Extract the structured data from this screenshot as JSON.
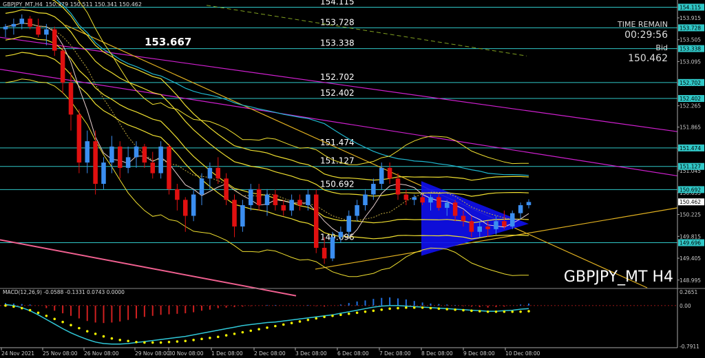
{
  "header": {
    "symbol_info": "GBPJPY_MT,H4",
    "ohlc": "150.379 150.511 150.341 150.462"
  },
  "info_panel": {
    "time_remain_label": "TIME REMAIN",
    "time_remain_value": "00:29:56",
    "bid_label": "Bid",
    "bid_value": "150.462"
  },
  "watermark": "GBPJPY_MT H4",
  "highlight_price": "153.667",
  "colors": {
    "background": "#000000",
    "level_line": "#30c8c8",
    "bull_candle": "#3b8ef0",
    "bear_candle": "#e01010",
    "band": "#f0e030",
    "trend_magenta": "#d020d0",
    "trend_orange": "#e0b020",
    "ma_cyan": "#20b8d0",
    "triangle": "#1010f0",
    "macd_hist_pos": "#2070e0",
    "macd_hist_neg": "#d02020",
    "macd_signal": "#f0f000",
    "macd_line": "#30c8d8",
    "current_price_tag": "#ffffff"
  },
  "chart_data": {
    "type": "candlestick",
    "title": "GBPJPY_MT H4",
    "y_ticks": [
      "153.915",
      "153.505",
      "153.095",
      "152.675",
      "152.265",
      "151.865",
      "151.455",
      "151.045",
      "150.635",
      "150.225",
      "149.815",
      "149.405",
      "148.995"
    ],
    "ylim": [
      148.85,
      154.25
    ],
    "x_ticks": [
      "24 Nov 2021",
      "25 Nov 08:00",
      "26 Nov 08:00",
      "29 Nov 08:00",
      "30 Nov 08:00",
      "1 Dec 08:00",
      "2 Dec 08:00",
      "3 Dec 08:00",
      "6 Dec 08:00",
      "7 Dec 08:00",
      "8 Dec 08:00",
      "9 Dec 08:00",
      "10 Dec 08:00"
    ],
    "price_levels": [
      "154.115",
      "153.728",
      "153.338",
      "152.702",
      "152.402",
      "151.474",
      "151.127",
      "150.692",
      "149.696"
    ],
    "current_price": "150.462",
    "candles": [
      [
        153.7,
        153.8,
        153.55,
        153.75
      ],
      [
        153.75,
        153.9,
        153.6,
        153.8
      ],
      [
        153.8,
        153.98,
        153.7,
        153.9
      ],
      [
        153.9,
        153.95,
        153.7,
        153.75
      ],
      [
        153.75,
        153.9,
        153.55,
        153.6
      ],
      [
        153.6,
        153.8,
        153.4,
        153.7
      ],
      [
        153.7,
        153.75,
        153.2,
        153.3
      ],
      [
        153.3,
        153.4,
        152.5,
        152.7
      ],
      [
        152.7,
        152.9,
        151.8,
        152.1
      ],
      [
        152.1,
        152.2,
        151.0,
        151.2
      ],
      [
        151.2,
        151.8,
        151.0,
        151.6
      ],
      [
        151.6,
        151.8,
        150.6,
        150.8
      ],
      [
        150.8,
        151.3,
        150.7,
        151.2
      ],
      [
        151.2,
        151.7,
        151.0,
        151.5
      ],
      [
        151.5,
        151.6,
        150.9,
        151.1
      ],
      [
        151.1,
        151.5,
        151.0,
        151.3
      ],
      [
        151.3,
        151.6,
        151.1,
        151.5
      ],
      [
        151.5,
        151.55,
        151.1,
        151.2
      ],
      [
        151.2,
        151.4,
        150.9,
        151.0
      ],
      [
        151.0,
        151.6,
        150.9,
        151.5
      ],
      [
        151.5,
        151.55,
        150.6,
        150.7
      ],
      [
        150.7,
        150.8,
        150.3,
        150.5
      ],
      [
        150.5,
        150.55,
        149.9,
        150.2
      ],
      [
        150.2,
        150.7,
        150.1,
        150.6
      ],
      [
        150.6,
        151.0,
        150.4,
        150.9
      ],
      [
        150.9,
        151.2,
        150.7,
        151.1
      ],
      [
        151.1,
        151.3,
        150.8,
        150.9
      ],
      [
        150.9,
        151.0,
        150.4,
        150.5
      ],
      [
        150.5,
        150.6,
        149.8,
        150.0
      ],
      [
        150.0,
        150.5,
        149.9,
        150.4
      ],
      [
        150.4,
        150.8,
        150.3,
        150.7
      ],
      [
        150.7,
        150.8,
        150.3,
        150.4
      ],
      [
        150.4,
        150.7,
        150.2,
        150.6
      ],
      [
        150.6,
        150.7,
        150.3,
        150.4
      ],
      [
        150.4,
        150.5,
        150.2,
        150.3
      ],
      [
        150.3,
        150.6,
        150.2,
        150.5
      ],
      [
        150.5,
        150.6,
        150.3,
        150.4
      ],
      [
        150.4,
        150.7,
        150.3,
        150.6
      ],
      [
        150.6,
        150.7,
        149.5,
        149.6
      ],
      [
        149.6,
        149.8,
        149.3,
        149.4
      ],
      [
        149.4,
        149.9,
        149.35,
        149.8
      ],
      [
        149.8,
        150.0,
        149.7,
        149.9
      ],
      [
        149.9,
        150.3,
        149.8,
        150.2
      ],
      [
        150.2,
        150.5,
        150.1,
        150.4
      ],
      [
        150.4,
        150.7,
        150.3,
        150.6
      ],
      [
        150.6,
        150.9,
        150.5,
        150.8
      ],
      [
        150.8,
        151.2,
        150.7,
        151.1
      ],
      [
        151.1,
        151.2,
        150.8,
        150.9
      ],
      [
        150.9,
        151.0,
        150.5,
        150.6
      ],
      [
        150.6,
        150.7,
        150.4,
        150.5
      ],
      [
        150.5,
        150.6,
        150.4,
        150.55
      ],
      [
        150.55,
        150.6,
        150.4,
        150.45
      ],
      [
        150.45,
        150.6,
        150.3,
        150.55
      ],
      [
        150.55,
        150.6,
        150.3,
        150.35
      ],
      [
        150.35,
        150.5,
        150.2,
        150.45
      ],
      [
        150.45,
        150.5,
        150.1,
        150.2
      ],
      [
        150.2,
        150.3,
        150.0,
        150.1
      ],
      [
        150.1,
        150.2,
        149.8,
        149.9
      ],
      [
        149.9,
        150.1,
        149.8,
        150.0
      ],
      [
        150.0,
        150.1,
        149.8,
        149.95
      ],
      [
        149.95,
        150.2,
        149.85,
        150.1
      ],
      [
        150.1,
        150.3,
        149.95,
        150.0
      ],
      [
        150.0,
        150.3,
        149.95,
        150.25
      ],
      [
        150.25,
        150.45,
        150.15,
        150.4
      ],
      [
        150.4,
        150.51,
        150.34,
        150.46
      ]
    ],
    "macd": {
      "label": "MACD(12,26,9) -0.0588 -0.1331 0.0743 0.0000",
      "y_ticks": [
        "0.2651",
        "0.00",
        "-0.7911"
      ],
      "ylim": [
        -0.82,
        0.32
      ],
      "histogram": [
        0.05,
        0.04,
        0.03,
        0.02,
        0.0,
        -0.05,
        -0.1,
        -0.15,
        -0.2,
        -0.25,
        -0.3,
        -0.33,
        -0.34,
        -0.33,
        -0.31,
        -0.28,
        -0.25,
        -0.22,
        -0.2,
        -0.18,
        -0.17,
        -0.16,
        -0.15,
        -0.13,
        -0.1,
        -0.08,
        -0.05,
        -0.04,
        -0.03,
        -0.02,
        -0.01,
        0.0,
        0.01,
        0.01,
        0.0,
        0.0,
        0.0,
        0.01,
        -0.01,
        -0.02,
        0.0,
        0.02,
        0.05,
        0.08,
        0.1,
        0.13,
        0.15,
        0.16,
        0.14,
        0.12,
        0.09,
        0.06,
        0.04,
        0.03,
        0.02,
        0.01,
        -0.01,
        -0.02,
        -0.03,
        -0.04,
        -0.03,
        -0.02,
        0.0,
        0.02,
        0.04
      ],
      "macd_line": [
        0.02,
        0.0,
        -0.04,
        -0.1,
        -0.18,
        -0.27,
        -0.36,
        -0.45,
        -0.53,
        -0.6,
        -0.66,
        -0.71,
        -0.74,
        -0.75,
        -0.75,
        -0.74,
        -0.72,
        -0.7,
        -0.68,
        -0.66,
        -0.64,
        -0.62,
        -0.6,
        -0.57,
        -0.54,
        -0.51,
        -0.48,
        -0.45,
        -0.42,
        -0.39,
        -0.37,
        -0.35,
        -0.33,
        -0.32,
        -0.3,
        -0.28,
        -0.26,
        -0.24,
        -0.22,
        -0.2,
        -0.18,
        -0.15,
        -0.12,
        -0.09,
        -0.06,
        -0.03,
        -0.01,
        0.0,
        0.0,
        -0.01,
        -0.02,
        -0.03,
        -0.04,
        -0.05,
        -0.06,
        -0.07,
        -0.08,
        -0.09,
        -0.1,
        -0.11,
        -0.11,
        -0.1,
        -0.09,
        -0.07,
        -0.06
      ],
      "signal_line": [
        0.0,
        -0.02,
        -0.05,
        -0.09,
        -0.14,
        -0.2,
        -0.26,
        -0.32,
        -0.38,
        -0.44,
        -0.5,
        -0.55,
        -0.6,
        -0.64,
        -0.67,
        -0.69,
        -0.71,
        -0.72,
        -0.72,
        -0.72,
        -0.71,
        -0.7,
        -0.69,
        -0.67,
        -0.65,
        -0.63,
        -0.61,
        -0.58,
        -0.55,
        -0.52,
        -0.49,
        -0.46,
        -0.43,
        -0.4,
        -0.37,
        -0.34,
        -0.31,
        -0.28,
        -0.25,
        -0.22,
        -0.2,
        -0.18,
        -0.16,
        -0.14,
        -0.12,
        -0.1,
        -0.08,
        -0.06,
        -0.05,
        -0.04,
        -0.04,
        -0.04,
        -0.05,
        -0.06,
        -0.07,
        -0.08,
        -0.09,
        -0.1,
        -0.11,
        -0.12,
        -0.12,
        -0.12,
        -0.12,
        -0.12,
        -0.11
      ]
    }
  }
}
